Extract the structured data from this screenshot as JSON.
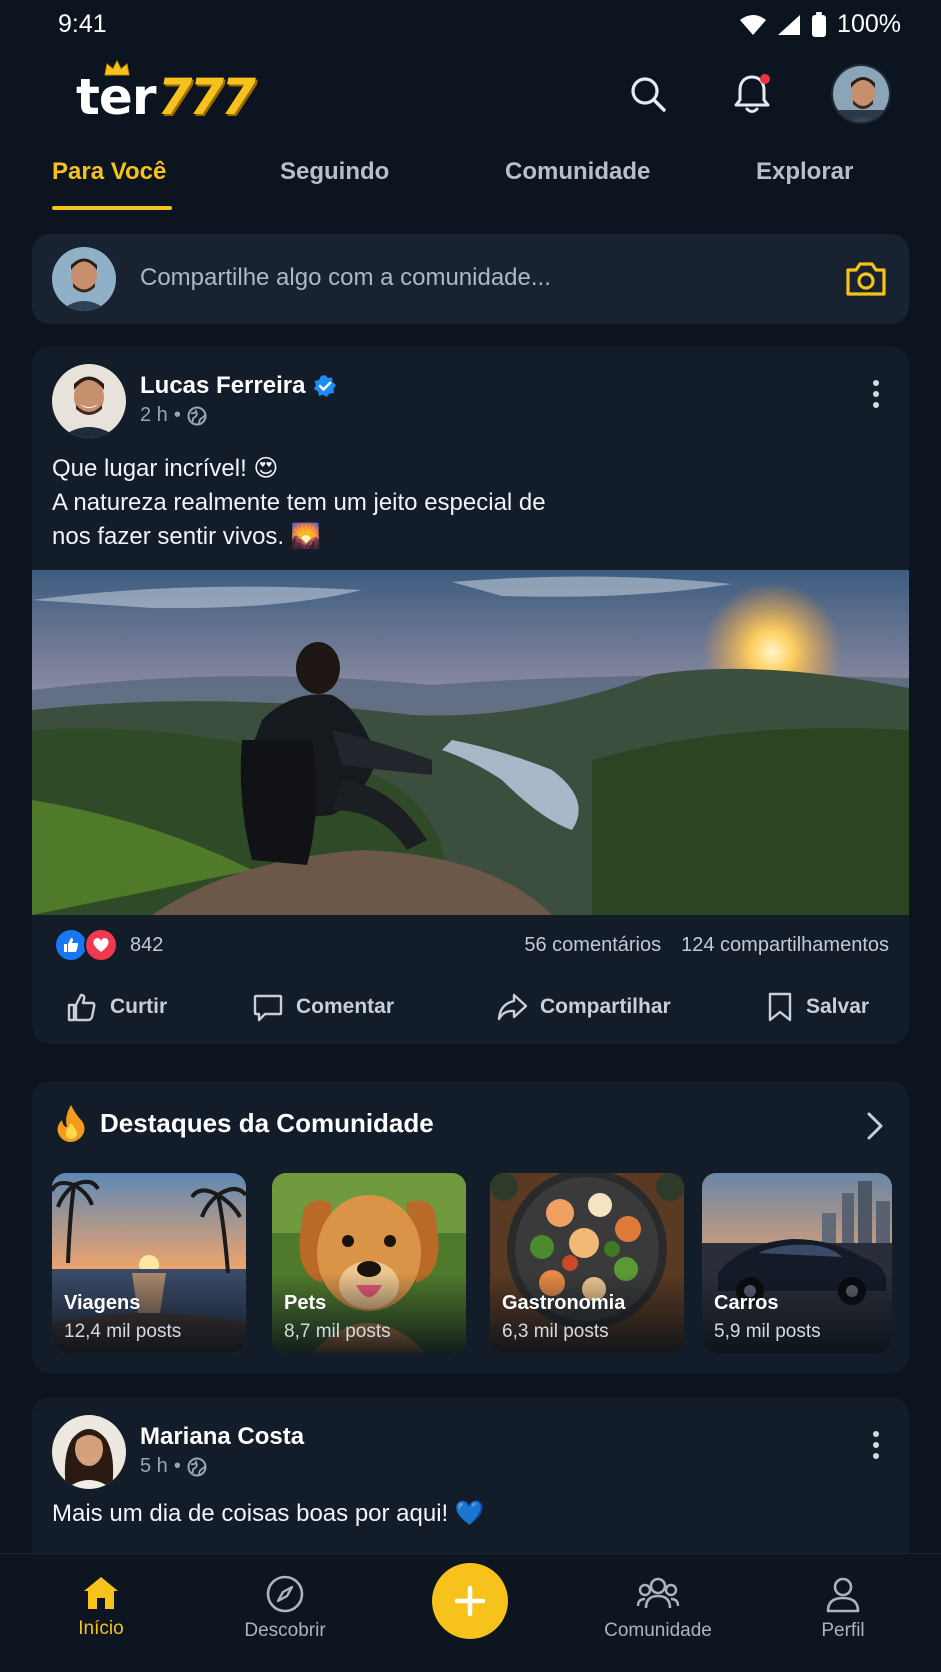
{
  "status": {
    "time": "9:41",
    "battery": "100%"
  },
  "header": {
    "logo_text": "ter",
    "logo_number": "777"
  },
  "tabs": [
    {
      "label": "Para Você",
      "active": true
    },
    {
      "label": "Seguindo",
      "active": false
    },
    {
      "label": "Comunidade",
      "active": false
    },
    {
      "label": "Explorar",
      "active": false
    }
  ],
  "composer": {
    "placeholder": "Compartilhe algo com a comunidade..."
  },
  "post": {
    "author": "Lucas Ferreira",
    "verified": true,
    "time": "2 h",
    "text_line1": "Que lugar incrível! 😍",
    "text_line2": "A natureza realmente tem um jeito especial de",
    "text_line3": "nos fazer sentir vivos. 🌄",
    "reactions_count": "842",
    "comments": "56 comentários",
    "shares": "124 compartilhamentos",
    "actions": {
      "like": "Curtir",
      "comment": "Comentar",
      "share": "Compartilhar",
      "save": "Salvar"
    }
  },
  "highlights": {
    "title": "Destaques da Comunidade",
    "items": [
      {
        "name": "Viagens",
        "count": "12,4 mil posts"
      },
      {
        "name": "Pets",
        "count": "8,7 mil posts"
      },
      {
        "name": "Gastronomia",
        "count": "6,3 mil posts"
      },
      {
        "name": "Carros",
        "count": "5,9 mil posts"
      }
    ]
  },
  "post2": {
    "author": "Mariana Costa",
    "time": "5 h",
    "text": "Mais um dia de coisas boas por aqui! 💙"
  },
  "nav": {
    "home": "Início",
    "discover": "Descobrir",
    "community": "Comunidade",
    "profile": "Perfil"
  },
  "colors": {
    "accent": "#f7c21b",
    "background": "#0c141f",
    "card": "#131c29",
    "notification": "#ef3340",
    "like": "#1877f2",
    "love": "#f0394f"
  }
}
